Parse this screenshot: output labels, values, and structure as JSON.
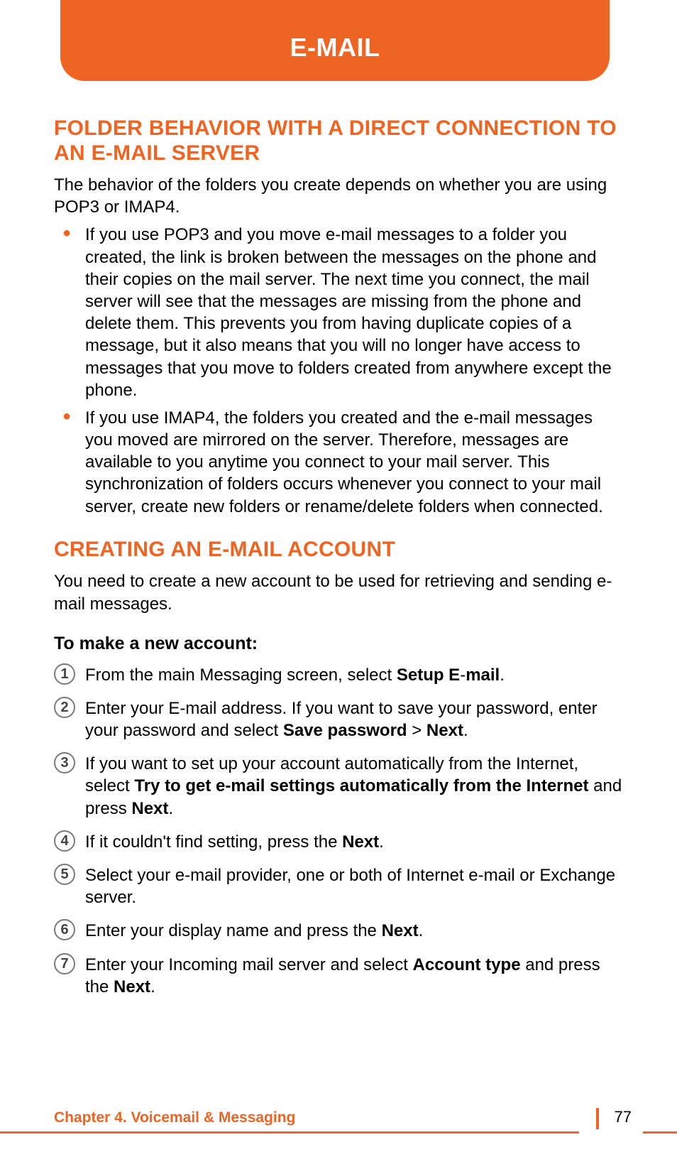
{
  "header": {
    "title": "E-MAIL"
  },
  "section1": {
    "title": "FOLDER BEHAVIOR WITH A DIRECT CONNECTION TO AN E-MAIL SERVER",
    "intro": "The behavior of the folders you create depends on whether you are using POP3 or IMAP4.",
    "bullets": [
      "If you use POP3 and you move e-mail messages to a folder you created, the link is broken between the messages on the phone and their copies on the mail server. The next time you connect, the mail server will see that the messages are missing from the phone and delete them. This prevents you from having duplicate copies of a message, but it also means that you will no longer have access to messages that you move to folders created from anywhere except the phone.",
      "If you use IMAP4, the folders you created and the e-mail messages you moved are mirrored on the server. Therefore, messages are available to you anytime you connect to your mail server. This synchronization of folders occurs whenever you connect to your mail server, create new folders or rename/delete folders when connected."
    ]
  },
  "section2": {
    "title": "CREATING AN E-MAIL ACCOUNT",
    "intro": "You need to create a new account to be used for retrieving and sending e-mail messages.",
    "subhead": "To make a new account:",
    "steps": [
      {
        "pre": "From the main Messaging screen, select ",
        "b1": "Setup E",
        "mid1": "-",
        "b2": "mail",
        "post": "."
      },
      {
        "pre": "Enter your E-mail address. If you want to save your password, enter your password and select ",
        "b1": "Save password",
        "mid1": " > ",
        "b2": "Next",
        "post": "."
      },
      {
        "pre": "If you want to set up your account automatically from the Internet, select ",
        "b1": "Try to get e-mail settings automatically from the Internet",
        "mid1": " and press ",
        "b2": "Next",
        "post": "."
      },
      {
        "pre": "If it couldn't find setting, press the ",
        "b1": "Next",
        "mid1": "",
        "b2": "",
        "post": "."
      },
      {
        "pre": "Select your e-mail provider, one or both of Internet e-mail or Exchange server.",
        "b1": "",
        "mid1": "",
        "b2": "",
        "post": ""
      },
      {
        "pre": "Enter your display name and press the ",
        "b1": "Next",
        "mid1": "",
        "b2": "",
        "post": "."
      },
      {
        "pre": "Enter your Incoming mail server and select ",
        "b1": "Account type",
        "mid1": " and press the ",
        "b2": "Next",
        "post": "."
      }
    ],
    "nums": [
      "1",
      "2",
      "3",
      "4",
      "5",
      "6",
      "7"
    ]
  },
  "footer": {
    "chapter": "Chapter 4. Voicemail & Messaging",
    "page": "77"
  }
}
